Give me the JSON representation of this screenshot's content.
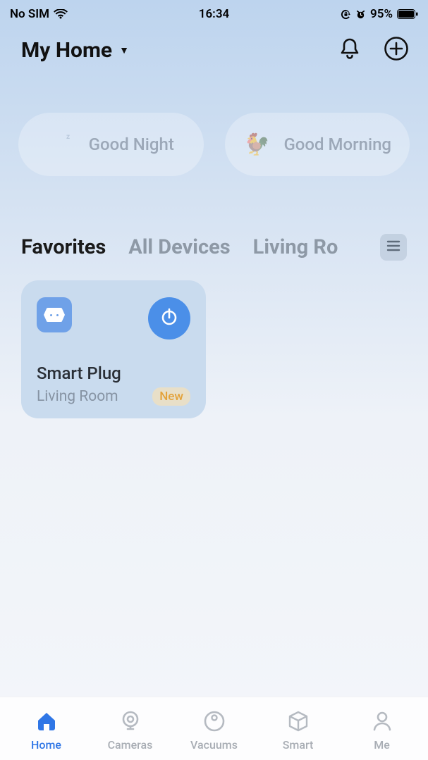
{
  "status": {
    "carrier": "No SIM",
    "time": "16:34",
    "battery": "95%"
  },
  "header": {
    "title": "My Home"
  },
  "scenes": [
    {
      "icon": "moon",
      "label": "Good Night"
    },
    {
      "icon": "bird",
      "label": "Good Morning"
    }
  ],
  "tabs": [
    {
      "label": "Favorites",
      "active": true
    },
    {
      "label": "All Devices",
      "active": false
    },
    {
      "label": "Living Ro",
      "active": false
    }
  ],
  "device": {
    "name": "Smart Plug",
    "room": "Living Room",
    "badge": "New"
  },
  "nav": [
    {
      "label": "Home",
      "active": true
    },
    {
      "label": "Cameras",
      "active": false
    },
    {
      "label": "Vacuums",
      "active": false
    },
    {
      "label": "Smart",
      "active": false
    },
    {
      "label": "Me",
      "active": false
    }
  ]
}
